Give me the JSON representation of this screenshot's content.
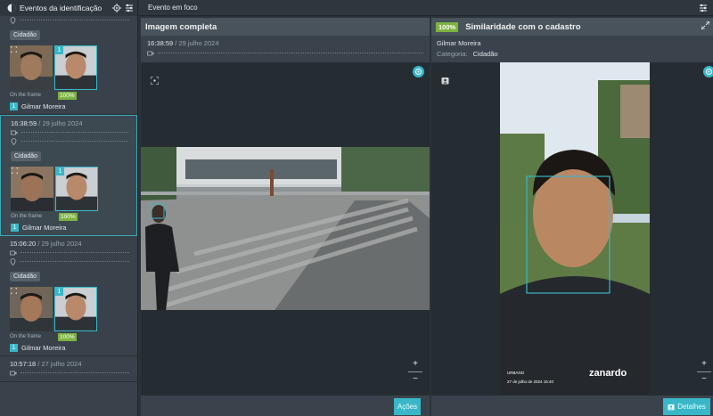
{
  "sidebar": {
    "title": "Eventos da identificação",
    "events": [
      {
        "time": "",
        "date": "",
        "tag": "Cidadão",
        "on_frame": "On the frame",
        "similarity": "100%",
        "rank": "1",
        "name": "Gilmar Moreira",
        "selected": false
      },
      {
        "time": "16:38:59",
        "date": " / 29 julho 2024",
        "tag": "Cidadão",
        "on_frame": "On the frame",
        "similarity": "100%",
        "rank": "1",
        "name": "Gilmar Moreira",
        "selected": true
      },
      {
        "time": "15:06:20",
        "date": " / 29 julho 2024",
        "tag": "Cidadão",
        "on_frame": "On the frame",
        "similarity": "100%",
        "rank": "1",
        "name": "Gilmar Moreira",
        "selected": false
      },
      {
        "time": "10:57:18",
        "date": " / 27 julho 2024",
        "tag": "",
        "on_frame": "",
        "similarity": "",
        "rank": "",
        "name": "",
        "selected": false
      }
    ]
  },
  "topbar": {
    "title": "Evento em foco"
  },
  "left_panel": {
    "title": "Imagem completa",
    "time": "16:38:59",
    "date": " / 29 julho 2024",
    "zoom_in": "+",
    "zoom_out": "−",
    "action_label": "Ações"
  },
  "right_panel": {
    "similarity": "100%",
    "title": "Similaridade com o cadastro",
    "person_name": "Gilmar Moreira",
    "category_label": "Categoria:",
    "category_value": "Cidadão",
    "photo_caption_1": "URBANO",
    "photo_caption_2": "27 de julho de 2024 15:40",
    "photo_brand": "zanardo",
    "zoom_in": "+",
    "zoom_out": "−",
    "details_label": "Detalhes"
  },
  "colors": {
    "accent": "#39b7c8",
    "match_green": "#7cb342",
    "panel_bg": "#3a434b"
  },
  "icons": [
    "face-id-icon",
    "target-icon",
    "filter-icon",
    "camera-icon",
    "location-icon",
    "scan-icon",
    "expand-icon",
    "id-card-icon"
  ]
}
